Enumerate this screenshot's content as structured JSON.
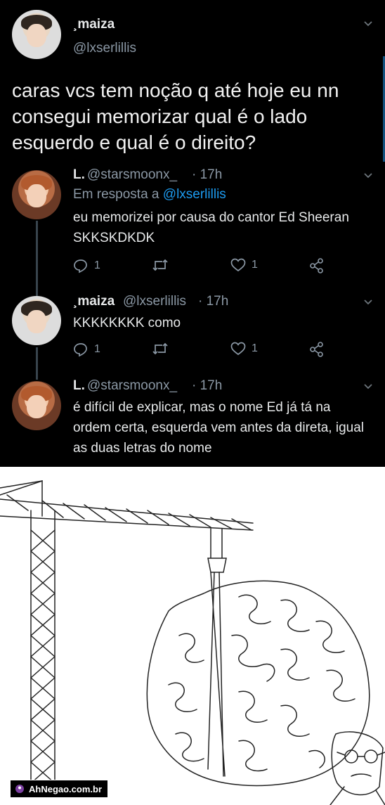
{
  "main_tweet": {
    "name": "¸maiza",
    "handle": "@lxserlillis",
    "text": "caras vcs tem noção q até hoje eu nn consegui memorizar qual é o lado esquerdo e qual é o direito?"
  },
  "replies": [
    {
      "name": "L.",
      "handle": "@starsmoonx_",
      "time": "· 17h",
      "reply_prefix": "Em resposta a",
      "reply_to": "@lxserlillis",
      "text": "eu memorizei por causa do cantor Ed Sheeran SKKSKDKDK",
      "reply_count": "1",
      "like_count": "1"
    },
    {
      "name": "¸maiza",
      "handle": "@lxserlillis",
      "time": "· 17h",
      "text": "KKKKKKKK como",
      "reply_count": "1",
      "like_count": "1"
    },
    {
      "name": "L.",
      "handle": "@starsmoonx_",
      "time": "· 17h",
      "text": "é difícil de explicar, mas o nome Ed já tá na ordem certa, esquerda vem antes da direta, igual as duas letras do nome"
    }
  ],
  "watermark": "AhNegao.com.br",
  "colors": {
    "background": "#000000",
    "link": "#1d9bf0",
    "muted": "#8b98a5"
  }
}
